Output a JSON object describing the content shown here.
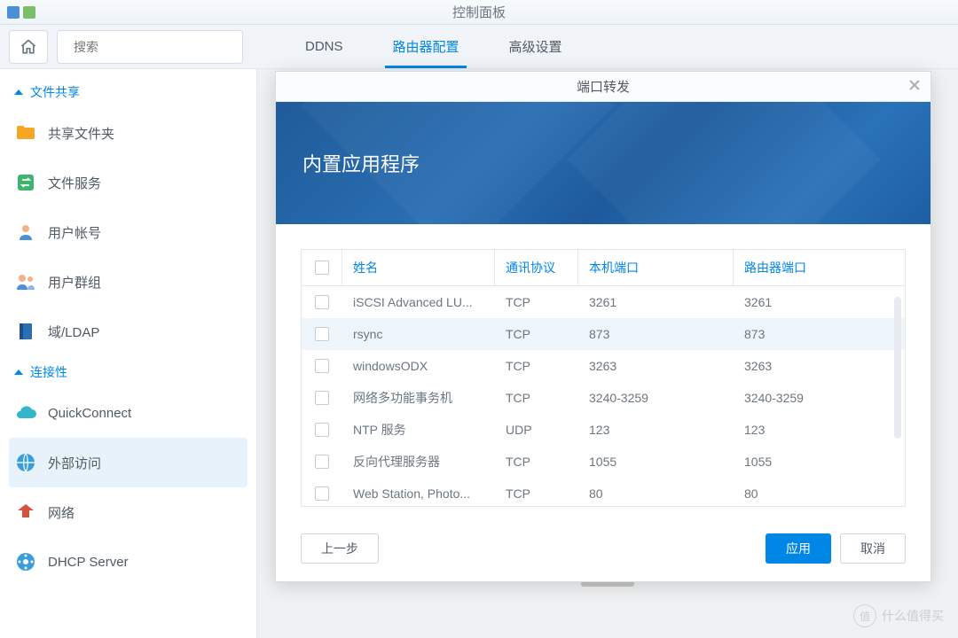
{
  "taskbar": {
    "title": "控制面板"
  },
  "search": {
    "placeholder": "搜索"
  },
  "tabs": [
    {
      "label": "DDNS",
      "active": false
    },
    {
      "label": "路由器配置",
      "active": true
    },
    {
      "label": "高级设置",
      "active": false
    }
  ],
  "sidebar": {
    "section1": {
      "label": "文件共享"
    },
    "section2": {
      "label": "连接性"
    },
    "items1": [
      {
        "label": "共享文件夹",
        "icon": "folder"
      },
      {
        "label": "文件服务",
        "icon": "swap"
      },
      {
        "label": "用户帐号",
        "icon": "user"
      },
      {
        "label": "用户群组",
        "icon": "group"
      },
      {
        "label": "域/LDAP",
        "icon": "book"
      }
    ],
    "items2": [
      {
        "label": "QuickConnect",
        "icon": "cloud"
      },
      {
        "label": "外部访问",
        "icon": "globe",
        "selected": true
      },
      {
        "label": "网络",
        "icon": "net"
      },
      {
        "label": "DHCP Server",
        "icon": "dhcp"
      }
    ]
  },
  "modal": {
    "title": "端口转发",
    "banner": "内置应用程序",
    "columns": {
      "name": "姓名",
      "proto": "通讯协议",
      "local": "本机端口",
      "router": "路由器端口"
    },
    "rows": [
      {
        "name": "iSCSI Advanced LU...",
        "proto": "TCP",
        "local": "3261",
        "router": "3261"
      },
      {
        "name": "rsync",
        "proto": "TCP",
        "local": "873",
        "router": "873",
        "hover": true
      },
      {
        "name": "windowsODX",
        "proto": "TCP",
        "local": "3263",
        "router": "3263"
      },
      {
        "name": "网络多功能事务机",
        "proto": "TCP",
        "local": "3240-3259",
        "router": "3240-3259"
      },
      {
        "name": "NTP 服务",
        "proto": "UDP",
        "local": "123",
        "router": "123"
      },
      {
        "name": "反向代理服务器",
        "proto": "TCP",
        "local": "1055",
        "router": "1055"
      },
      {
        "name": "Web Station, Photo...",
        "proto": "TCP",
        "local": "80",
        "router": "80"
      }
    ],
    "buttons": {
      "prev": "上一步",
      "apply": "应用",
      "cancel": "取消"
    }
  },
  "watermark": {
    "badge": "值",
    "text": "什么值得买"
  }
}
